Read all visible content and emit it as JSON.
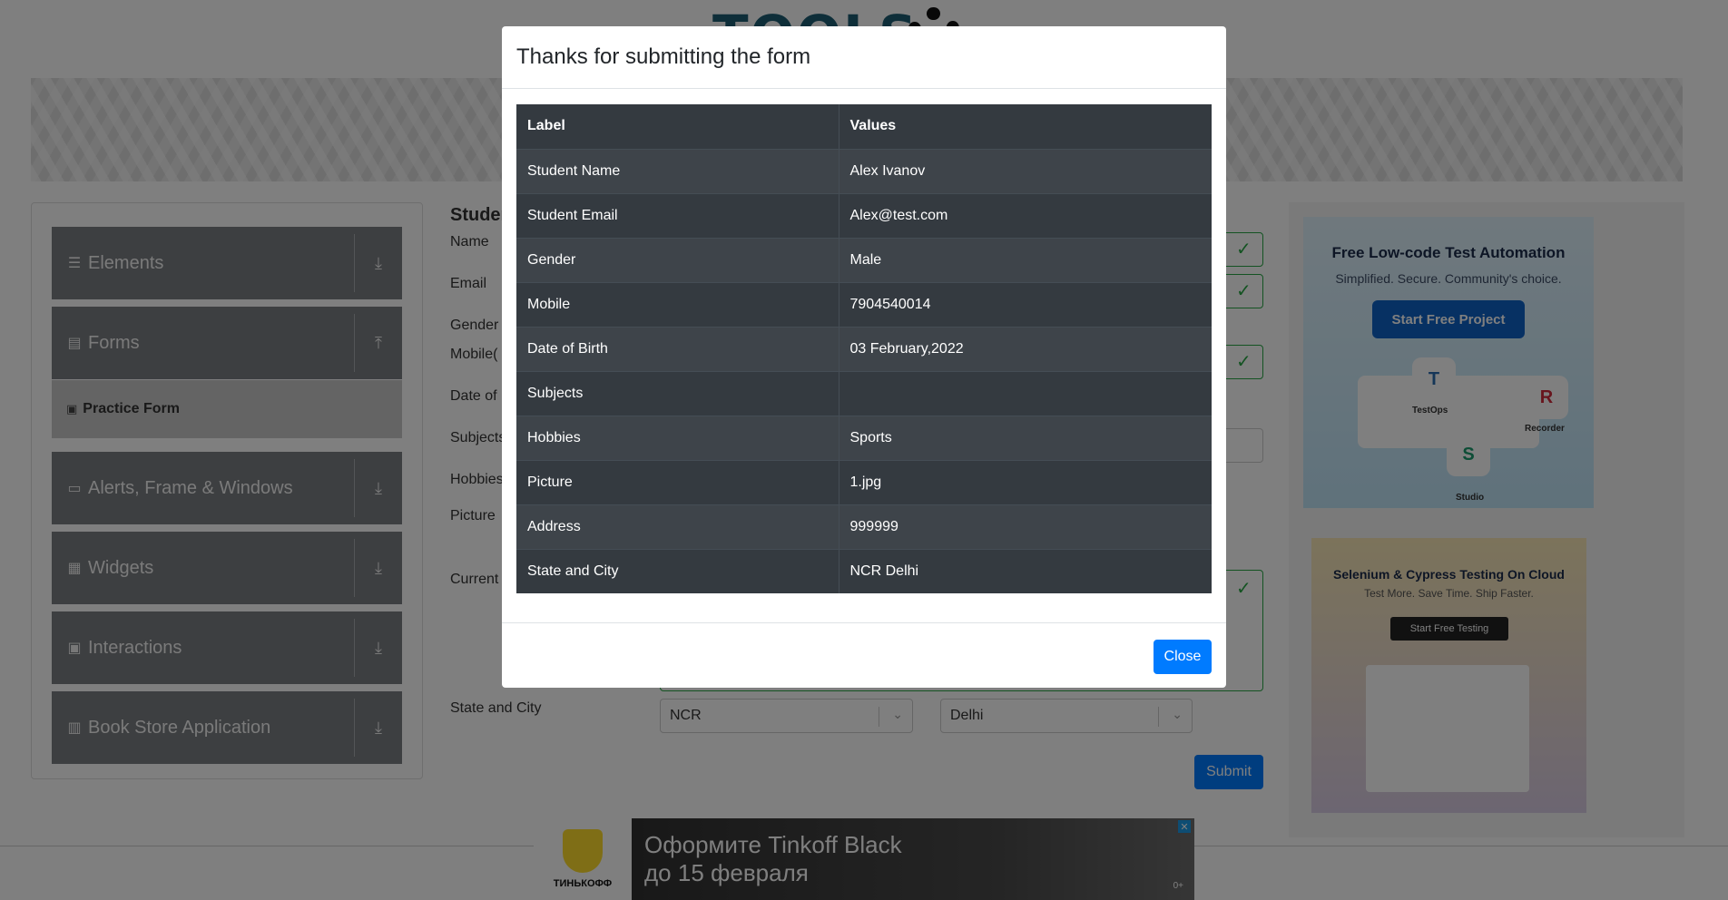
{
  "header": {
    "logo_text": "TOOLS"
  },
  "sidebar": {
    "groups": [
      {
        "label": "Elements",
        "icon": "hamburger-icon"
      },
      {
        "label": "Forms",
        "icon": "document-icon"
      },
      {
        "label": "Alerts, Frame & Windows",
        "icon": "window-icon"
      },
      {
        "label": "Widgets",
        "icon": "widgets-icon"
      },
      {
        "label": "Interactions",
        "icon": "interactions-icon"
      },
      {
        "label": "Book Store Application",
        "icon": "books-icon"
      }
    ],
    "active_item": "Practice Form"
  },
  "form": {
    "title": "Studen",
    "labels": {
      "name": "Name",
      "email": "Email",
      "gender": "Gender",
      "mobile": "Mobile(",
      "dob": "Date of",
      "subjects": "Subjects",
      "hobbies": "Hobbies",
      "picture": "Picture",
      "address": "Current",
      "state_city": "State and City"
    },
    "state_value": "NCR",
    "city_value": "Delhi",
    "submit_label": "Submit"
  },
  "ads": {
    "ad1": {
      "title": "Free Low-code Test Automation",
      "subtitle": "Simplified. Secure. Community's choice.",
      "button": "Start Free Project",
      "tiles": [
        "TestOps",
        "Recorder",
        "Studio"
      ]
    },
    "ad2": {
      "title": "Selenium & Cypress Testing On Cloud",
      "subtitle": "Test More. Save Time. Ship Faster.",
      "button": "Start Free Testing"
    },
    "bottom": {
      "brand": "ТИНЬКОФФ",
      "line1": "Оформите Tinkoff Black",
      "line2": "до 15 февраля",
      "age": "0+",
      "close": "✕"
    }
  },
  "modal": {
    "title": "Thanks for submitting the form",
    "columns": [
      "Label",
      "Values"
    ],
    "rows": [
      {
        "label": "Student Name",
        "value": "Alex Ivanov"
      },
      {
        "label": "Student Email",
        "value": "Alex@test.com"
      },
      {
        "label": "Gender",
        "value": "Male"
      },
      {
        "label": "Mobile",
        "value": "7904540014"
      },
      {
        "label": "Date of Birth",
        "value": "03 February,2022"
      },
      {
        "label": "Subjects",
        "value": ""
      },
      {
        "label": "Hobbies",
        "value": "Sports"
      },
      {
        "label": "Picture",
        "value": "1.jpg"
      },
      {
        "label": "Address",
        "value": "999999"
      },
      {
        "label": "State and City",
        "value": "NCR Delhi"
      }
    ],
    "close_label": "Close"
  }
}
